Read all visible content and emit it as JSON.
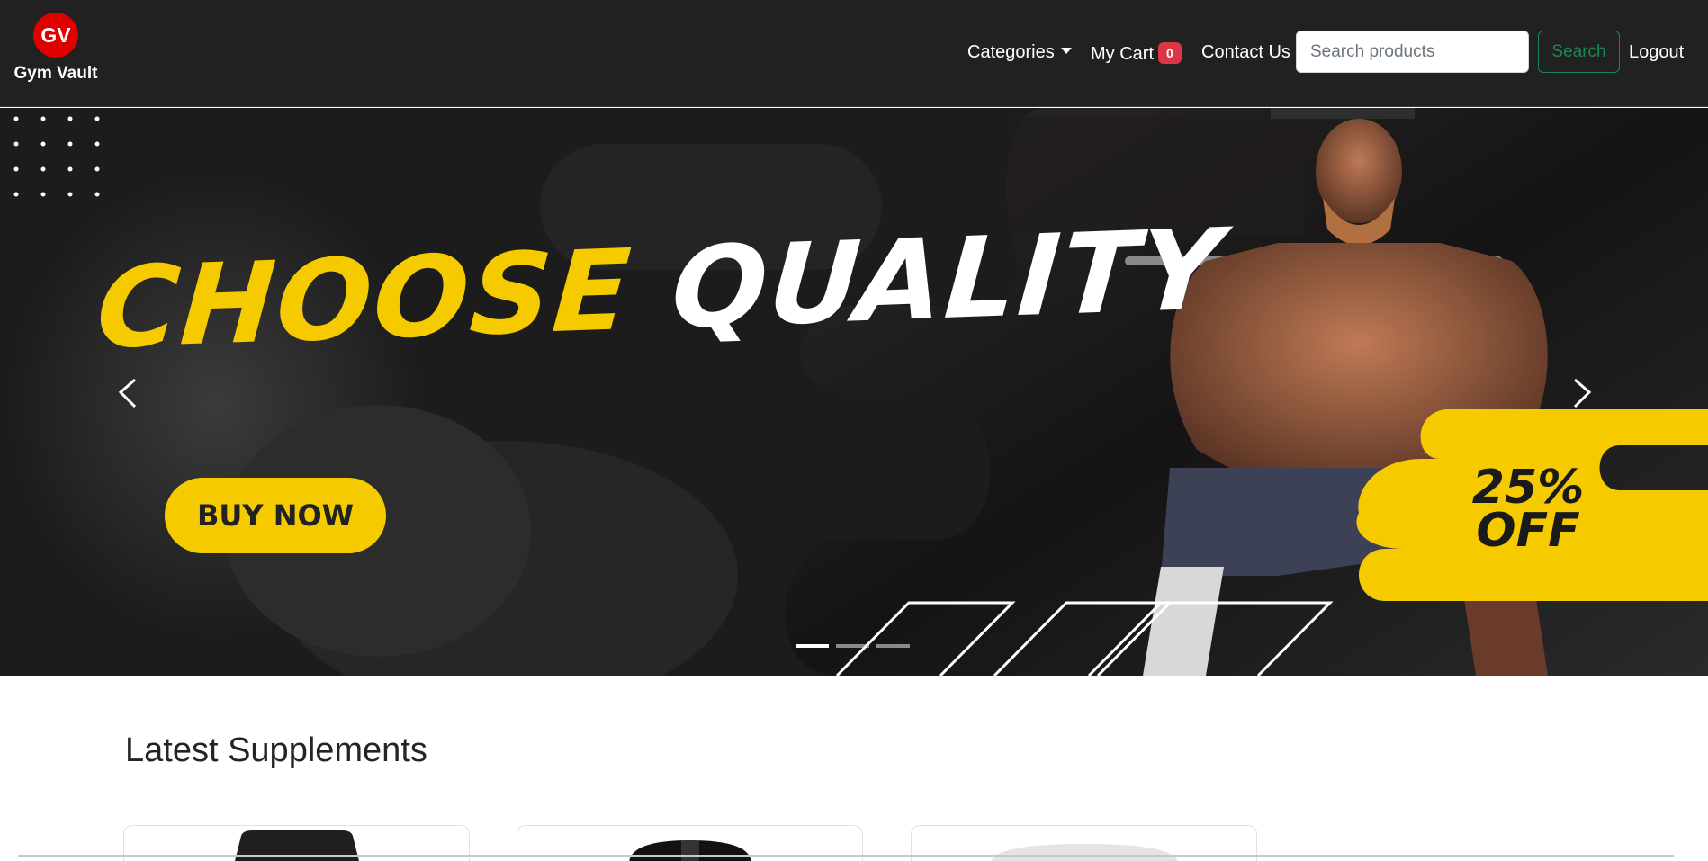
{
  "brand": {
    "logo_text": "GV",
    "name": "Gym Vault"
  },
  "nav": {
    "categories_label": "Categories",
    "cart_label": "My Cart",
    "cart_count": "0",
    "contact_label": "Contact Us",
    "search_placeholder": "Search products",
    "search_button": "Search",
    "logout_label": "Logout"
  },
  "carousel": {
    "headline_yellow": "CHOOSE",
    "headline_white": "QUALITY",
    "buy_button": "BUY NOW",
    "offer_line1": "25%",
    "offer_line2": "OFF",
    "slide_count": 3,
    "active_slide": 1,
    "prev_icon": "chevron-left-icon",
    "next_icon": "chevron-right-icon"
  },
  "colors": {
    "navbar_bg": "#212121",
    "accent_yellow": "#f5cb00",
    "brand_red": "#e00000",
    "badge_red": "#dc3545",
    "search_green": "#198754"
  },
  "section": {
    "title": "Latest Supplements"
  }
}
